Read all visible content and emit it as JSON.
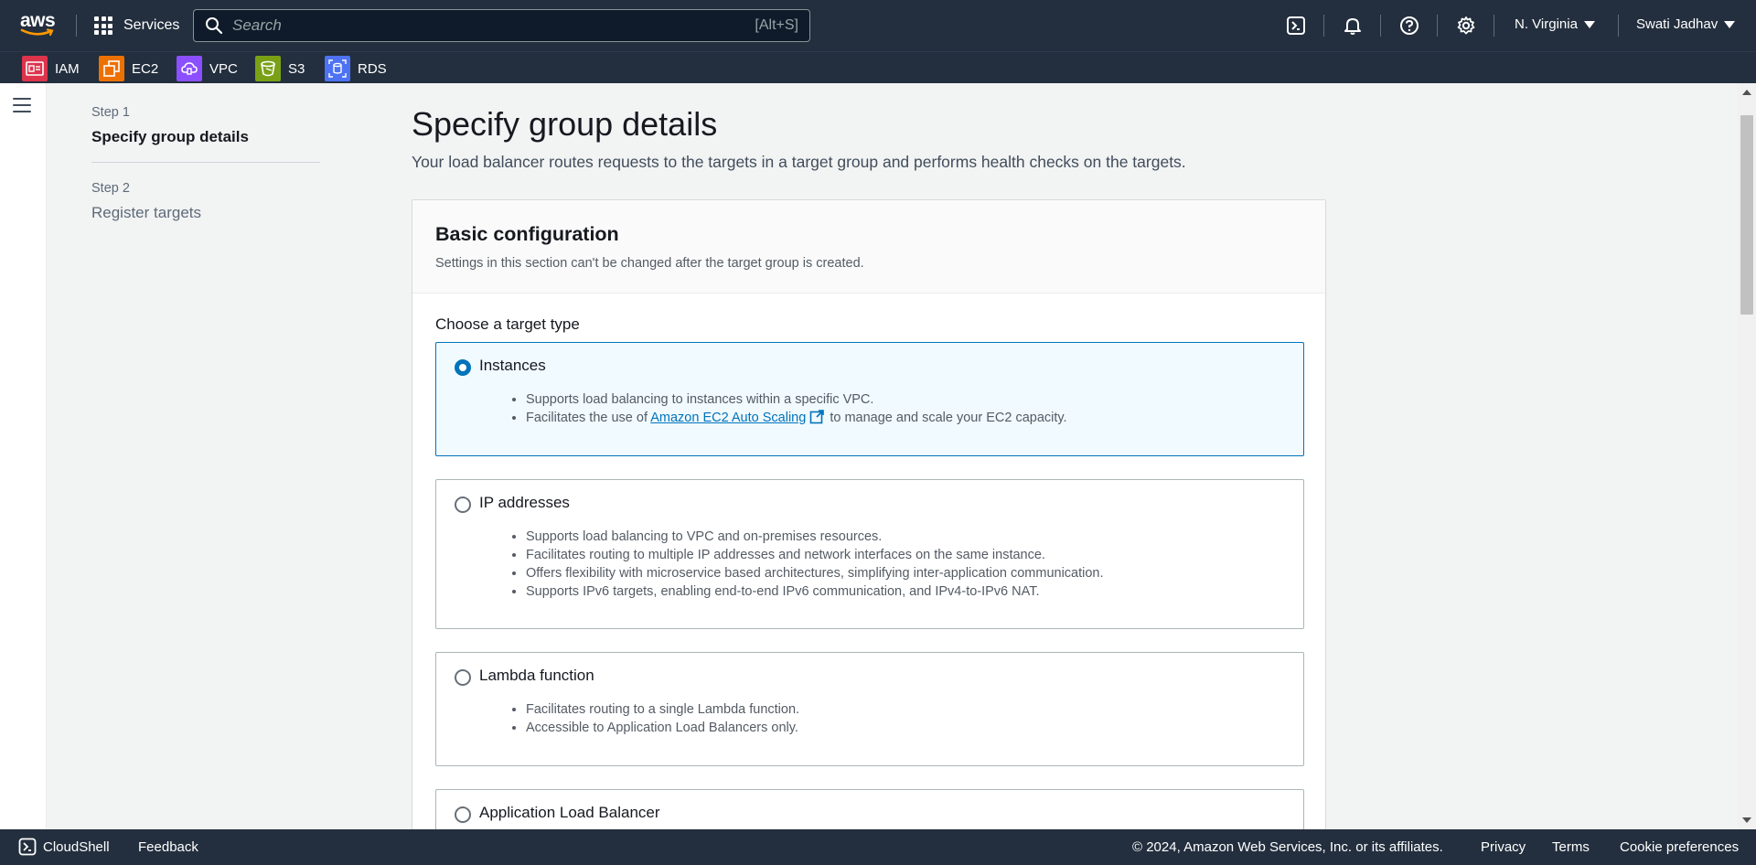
{
  "topnav": {
    "logo_text": "aws",
    "services_label": "Services",
    "search_placeholder": "Search",
    "search_shortcut": "[Alt+S]",
    "region_label": "N. Virginia",
    "user_label": "Swati Jadhav"
  },
  "favorites": [
    {
      "label": "IAM",
      "color": "#dd344c",
      "icon": "iam-icon"
    },
    {
      "label": "EC2",
      "color": "#ed7100",
      "icon": "ec2-icon"
    },
    {
      "label": "VPC",
      "color": "#8c4fff",
      "icon": "vpc-icon"
    },
    {
      "label": "S3",
      "color": "#7aa116",
      "icon": "s3-icon"
    },
    {
      "label": "RDS",
      "color": "#4d72f3",
      "icon": "rds-icon"
    }
  ],
  "steps": [
    {
      "step": "Step 1",
      "title": "Specify group details"
    },
    {
      "step": "Step 2",
      "title": "Register targets"
    }
  ],
  "header": {
    "title": "Specify group details",
    "description": "Your load balancer routes requests to the targets in a target group and performs health checks on the targets."
  },
  "basic_config": {
    "title": "Basic configuration",
    "subtitle": "Settings in this section can't be changed after the target group is created.",
    "choose_label": "Choose a target type",
    "options": [
      {
        "label": "Instances",
        "selected": true,
        "bullets": [
          "Supports load balancing to instances within a specific VPC."
        ],
        "bullet2_prefix": "Facilitates the use of ",
        "bullet2_link": "Amazon EC2 Auto Scaling",
        "bullet2_suffix": " to manage and scale your EC2 capacity."
      },
      {
        "label": "IP addresses",
        "selected": false,
        "bullets": [
          "Supports load balancing to VPC and on-premises resources.",
          "Facilitates routing to multiple IP addresses and network interfaces on the same instance.",
          "Offers flexibility with microservice based architectures, simplifying inter-application communication.",
          "Supports IPv6 targets, enabling end-to-end IPv6 communication, and IPv4-to-IPv6 NAT."
        ]
      },
      {
        "label": "Lambda function",
        "selected": false,
        "bullets": [
          "Facilitates routing to a single Lambda function.",
          "Accessible to Application Load Balancers only."
        ]
      },
      {
        "label": "Application Load Balancer",
        "selected": false,
        "bullets": []
      }
    ]
  },
  "footer": {
    "cloudshell": "CloudShell",
    "feedback": "Feedback",
    "copyright": "© 2024, Amazon Web Services, Inc. or its affiliates.",
    "privacy": "Privacy",
    "terms": "Terms",
    "cookie": "Cookie preferences"
  },
  "colors": {
    "nav_bg": "#232f3e",
    "accent": "#0073bb",
    "aws_orange": "#ff9900"
  }
}
